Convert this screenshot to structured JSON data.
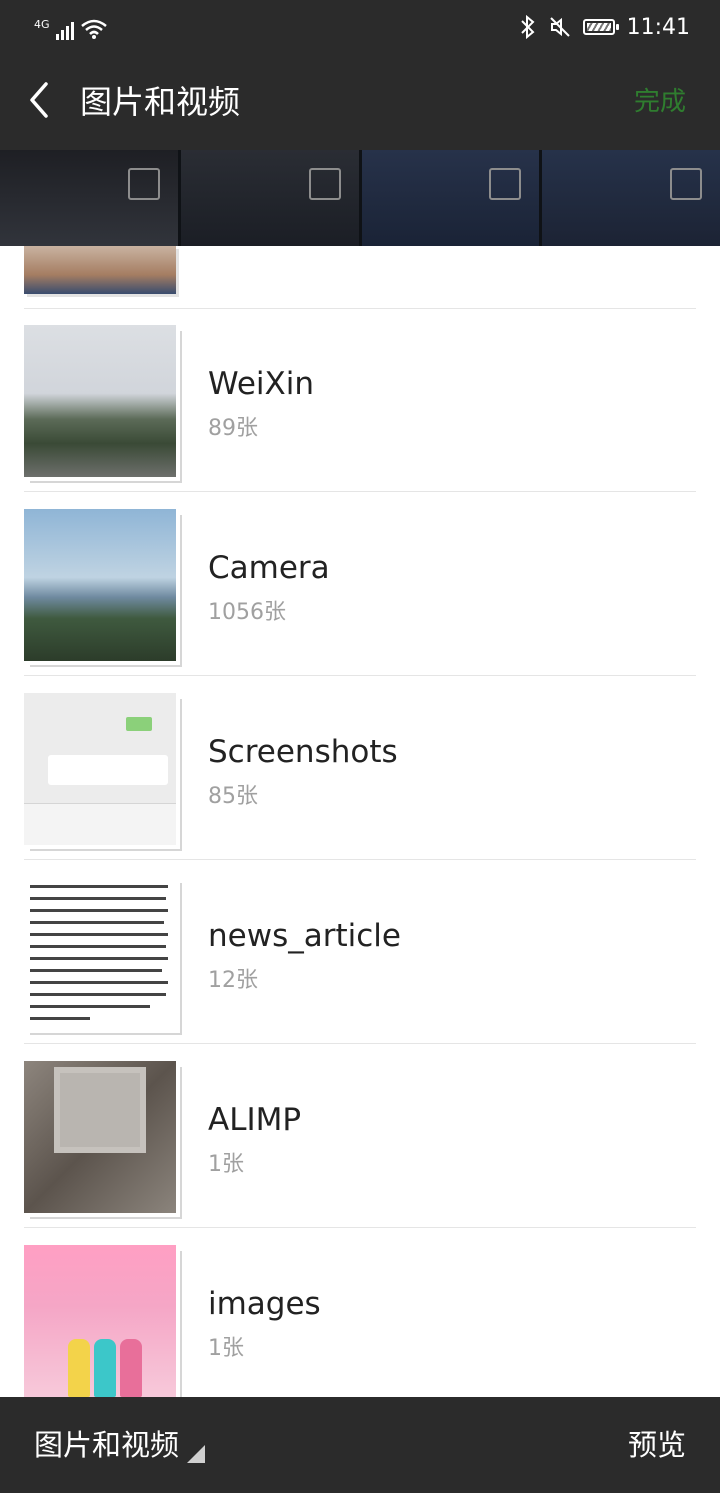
{
  "status_bar": {
    "network": "4G",
    "time": "11:41"
  },
  "header": {
    "title": "图片和视频",
    "done_label": "完成"
  },
  "albums": [
    {
      "name": "WeiXin",
      "count": "89张"
    },
    {
      "name": "Camera",
      "count": "1056张"
    },
    {
      "name": "Screenshots",
      "count": "85张"
    },
    {
      "name": "news_article",
      "count": "12张"
    },
    {
      "name": "ALIMP",
      "count": "1张"
    },
    {
      "name": "images",
      "count": "1张"
    }
  ],
  "footer": {
    "album_selector": "图片和视频",
    "preview_label": "预览"
  },
  "icons": {
    "back": "back-arrow-icon",
    "checkbox": "checkbox-icon",
    "dropdown": "triangle-corner-icon"
  }
}
